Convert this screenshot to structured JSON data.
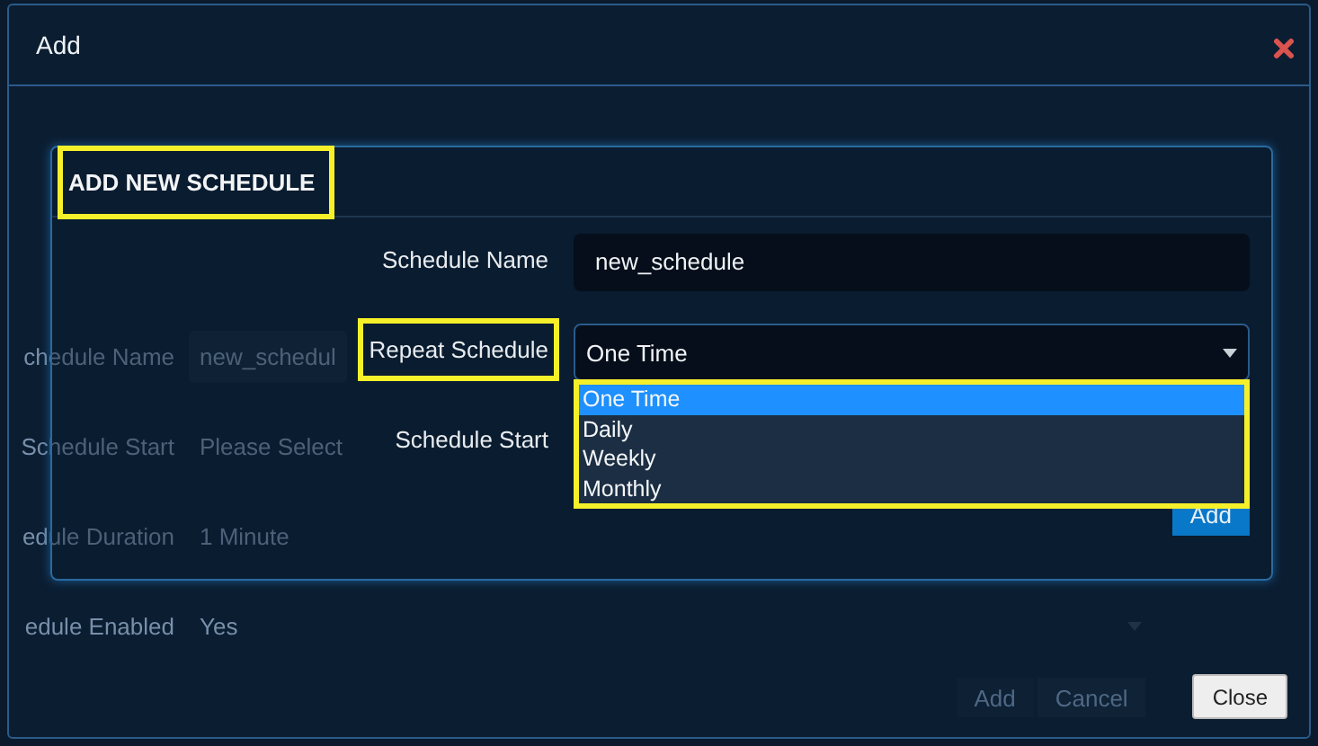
{
  "dialog": {
    "title": "Add"
  },
  "background_form": {
    "rows": [
      {
        "label": "chedule Name",
        "kind": "input",
        "value": "new_schedul"
      },
      {
        "label": "Schedule Start",
        "kind": "text",
        "value": "Please Select"
      },
      {
        "label": "edule Duration",
        "kind": "text",
        "value": "1 Minute"
      },
      {
        "label": "edule Enabled",
        "kind": "select",
        "value": "Yes"
      }
    ],
    "buttons": [
      "Add",
      "Cancel"
    ]
  },
  "panel": {
    "title": "ADD NEW SCHEDULE",
    "title_highlighted": true,
    "fields": [
      {
        "label": "Schedule Name",
        "kind": "input",
        "value": "new_schedule",
        "highlighted": false
      },
      {
        "label": "Repeat Schedule",
        "kind": "select",
        "value": "One Time",
        "highlighted": true,
        "expanded": true,
        "options_highlighted": true,
        "options": [
          {
            "label": "One Time",
            "selected": true
          },
          {
            "label": "Daily",
            "selected": false
          },
          {
            "label": "Weekly",
            "selected": false
          },
          {
            "label": "Monthly",
            "selected": false
          }
        ]
      },
      {
        "label": "Schedule Start",
        "kind": "empty",
        "highlighted": false
      }
    ],
    "add_button": "Add"
  },
  "close_button": "Close"
}
